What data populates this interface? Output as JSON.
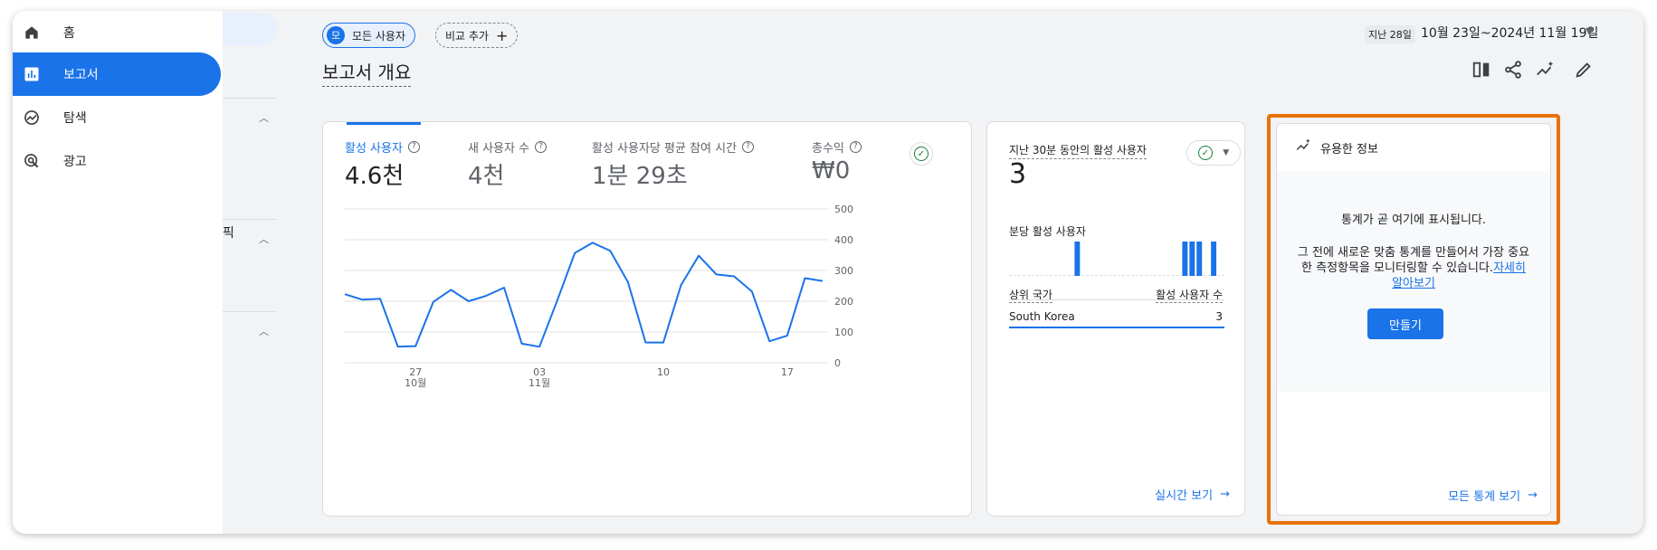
{
  "nav": {
    "items": [
      {
        "label": "홈",
        "icon": "home-icon",
        "active": false
      },
      {
        "label": "보고서",
        "icon": "bar-chart-icon",
        "active": true
      },
      {
        "label": "탐색",
        "icon": "explore-icon",
        "active": false
      },
      {
        "label": "광고",
        "icon": "advertising-icon",
        "active": false
      }
    ],
    "subpanel_partial_text": "픽"
  },
  "header": {
    "segment_chip_avatar": "모",
    "segment_chip_label": "모든 사용자",
    "add_comparison_label": "비교 추가",
    "date_tag": "지난 28일",
    "date_range": "10월 23일~2024년 11월 19일",
    "page_title": "보고서 개요"
  },
  "metrics": [
    {
      "label": "활성 사용자",
      "value": "4.6천",
      "selected": true
    },
    {
      "label": "새 사용자 수",
      "value": "4천",
      "selected": false
    },
    {
      "label": "활성 사용자당 평균 참여 시간",
      "value": "1분 29초",
      "selected": false
    },
    {
      "label": "총수익",
      "value": "₩0",
      "selected": false
    }
  ],
  "chart_data": {
    "type": "line",
    "series": [
      {
        "values": [
          223,
          205,
          208,
          52,
          54,
          198,
          237,
          200,
          218,
          244,
          62,
          52,
          202,
          357,
          390,
          364,
          262,
          66,
          66,
          253,
          348,
          287,
          281,
          232,
          70,
          88,
          275,
          266
        ]
      }
    ],
    "ylim": [
      0,
      500
    ],
    "y_ticks": [
      "500",
      "400",
      "300",
      "200",
      "100",
      "0"
    ],
    "x_ticks": [
      {
        "day": "27",
        "month": "10월",
        "index": 4
      },
      {
        "day": "03",
        "month": "11월",
        "index": 11
      },
      {
        "day": "10",
        "month": "",
        "index": 18
      },
      {
        "day": "17",
        "month": "",
        "index": 25
      }
    ],
    "colors": {
      "line": "#1a73e8",
      "grid": "#e0e0e0"
    }
  },
  "realtime": {
    "title": "지난 30분 동안의 활성 사용자",
    "value": "3",
    "per_minute_label": "분당 활성 사용자",
    "per_minute_bars": [
      0,
      0,
      0,
      0,
      0,
      0,
      0,
      0,
      0,
      1,
      0,
      0,
      0,
      0,
      0,
      0,
      0,
      0,
      0,
      0,
      0,
      0,
      0,
      0,
      1,
      1,
      1,
      0,
      1,
      0
    ],
    "col_country": "상위 국가",
    "col_users": "활성 사용자 수",
    "rows": [
      {
        "country": "South Korea",
        "users": "3"
      }
    ],
    "link": "실시간 보기"
  },
  "insights": {
    "title": "유용한 정보",
    "message": "통계가 곧 여기에 표시됩니다.",
    "description": "그 전에 새로운 맞춤 통계를 만들어서 가장 중요한 측정항목을 모니터링할 수 있습니다.",
    "learn_more": "자세히 알아보기",
    "create_button": "만들기",
    "view_all": "모든 통계 보기",
    "highlight_color": "#e8710a"
  }
}
